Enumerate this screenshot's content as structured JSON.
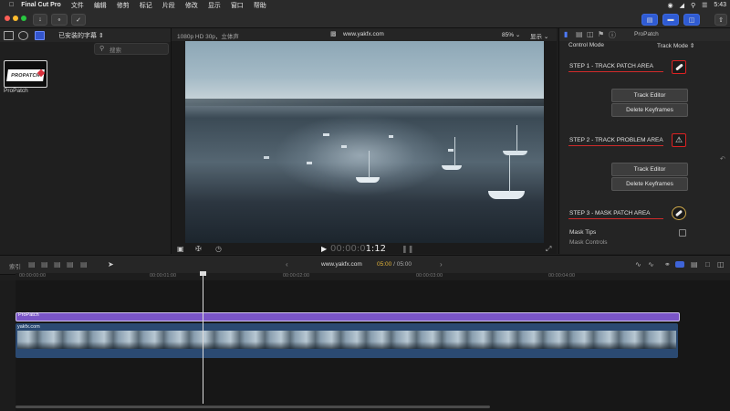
{
  "menubar": {
    "apple_icon": "apple-icon",
    "app_name": "Final Cut Pro",
    "menus": [
      "文件",
      "编辑",
      "修剪",
      "标记",
      "片段",
      "修改",
      "显示",
      "窗口",
      "帮助"
    ],
    "clock": "5:43"
  },
  "toolbar": {
    "icons": [
      "import-icon",
      "key-icon",
      "check-icon"
    ],
    "share_icon": "share-icon"
  },
  "browser": {
    "library_selector": "已安装的字幕",
    "search_placeholder": "搜索",
    "thumb_caption": "ProPatch",
    "thumb_badge": "PROPATCH"
  },
  "viewer": {
    "format_label": "1080p HD 30p，立体声",
    "clip_title": "www.yakfx.com",
    "zoom": "85%",
    "display_menu": "显示",
    "timecode": "00:00:01:12",
    "timecode_dim": "00:00:0",
    "timecode_bright": "1:12"
  },
  "inspector": {
    "title": "ProPatch",
    "control_mode_label": "Control Mode",
    "control_mode_value": "Track Mode",
    "step1_label": "STEP 1 - TRACK PATCH AREA",
    "step2_label": "STEP 2 - TRACK PROBLEM AREA",
    "step3_label": "STEP 3 - MASK PATCH AREA",
    "track_editor_1": "Track Editor",
    "delete_keyframes_1": "Delete Keyframes",
    "track_editor_2": "Track Editor",
    "delete_keyframes_2": "Delete Keyframes",
    "mask_tips_label": "Mask Tips",
    "mask_controls_label": "Mask Controls",
    "accent_red": "#cf2b2b"
  },
  "timeline": {
    "index_label": "索引",
    "project_name": "www.yakfx.com",
    "time_current": "05:00",
    "time_total": "/ 05:00",
    "ruler_marks": [
      "00:00:00:00",
      "00:00:01:00",
      "00:00:02:00",
      "00:00:03:00",
      "00:00:04:00"
    ],
    "title_clip_label": "ProPatch",
    "video_clip_label": "yakfx.com",
    "title_clip_color": "#7a55c7",
    "video_clip_color": "#2b4a72"
  }
}
